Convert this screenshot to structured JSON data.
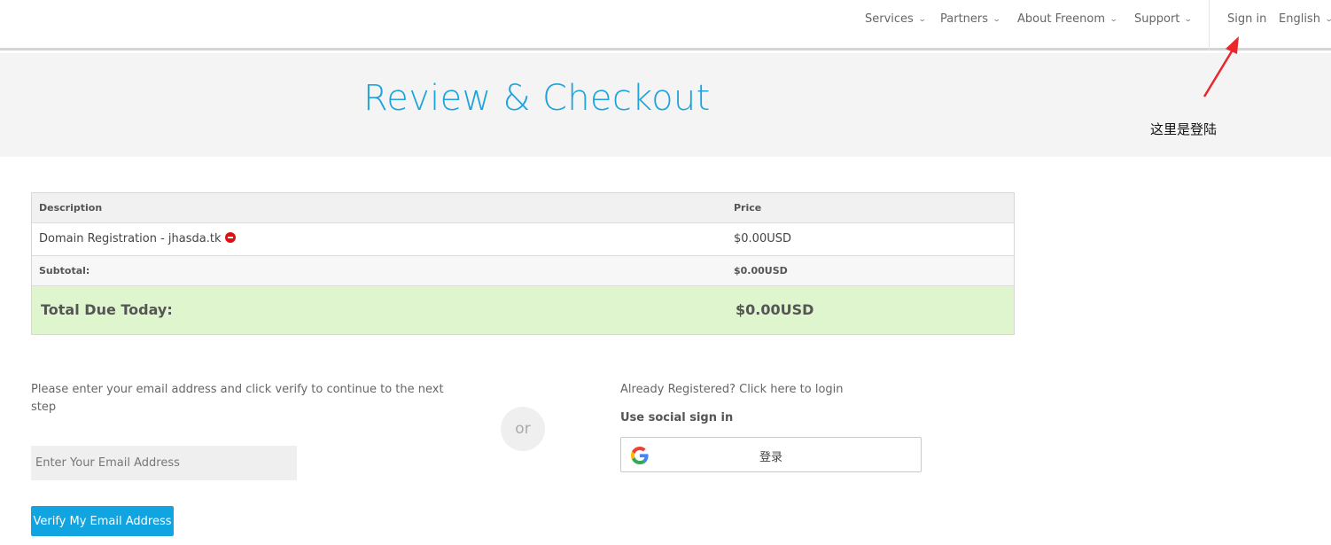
{
  "nav": {
    "items": [
      {
        "label": "Services"
      },
      {
        "label": "Partners"
      },
      {
        "label": "About Freenom"
      },
      {
        "label": "Support"
      }
    ],
    "sign_in": "Sign in",
    "language": "English"
  },
  "hero": {
    "title": "Review & Checkout"
  },
  "annotation": {
    "text": "这里是登陆",
    "color": "#e8262b"
  },
  "cart": {
    "columns": [
      "Description",
      "Price"
    ],
    "items": [
      {
        "description": "Domain Registration - jhasda.tk",
        "price": "$0.00USD"
      }
    ],
    "subtotal_label": "Subtotal:",
    "subtotal_value": "$0.00USD",
    "total_label": "Total Due Today:",
    "total_value": "$0.00USD"
  },
  "email_section": {
    "prompt": "Please enter your email address and click verify to continue to the next step",
    "input_placeholder": "Enter Your Email Address",
    "input_value": "",
    "verify_button": "Verify My Email Address"
  },
  "divider": {
    "text": "or"
  },
  "login_section": {
    "already_registered": "Already Registered? Click here to login",
    "social_label": "Use social sign in",
    "google_button": "登录"
  },
  "colors": {
    "accent": "#1ea3dc",
    "button": "#10a4e0",
    "total_row": "#dff5ce",
    "remove_icon": "#dd1111"
  }
}
